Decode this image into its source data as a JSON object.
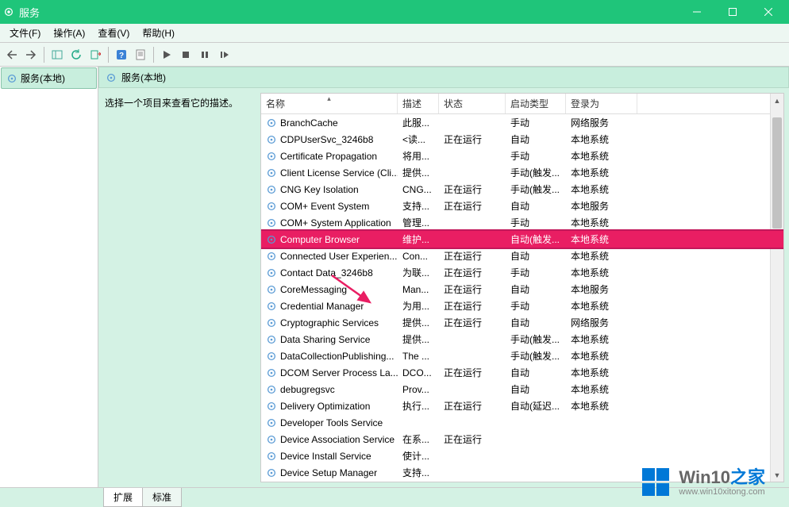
{
  "title": "服务",
  "menu": {
    "file": "文件(F)",
    "action": "操作(A)",
    "view": "查看(V)",
    "help": "帮助(H)"
  },
  "tree": {
    "root": "服务(本地)"
  },
  "pane": {
    "title": "服务(本地)",
    "desc_placeholder": "选择一个项目来查看它的描述。"
  },
  "columns": {
    "name": "名称",
    "desc": "描述",
    "state": "状态",
    "startup": "启动类型",
    "logon": "登录为"
  },
  "services": [
    {
      "name": "BranchCache",
      "desc": "此服...",
      "state": "",
      "startup": "手动",
      "logon": "网络服务"
    },
    {
      "name": "CDPUserSvc_3246b8",
      "desc": "<读...",
      "state": "正在运行",
      "startup": "自动",
      "logon": "本地系统"
    },
    {
      "name": "Certificate Propagation",
      "desc": "将用...",
      "state": "",
      "startup": "手动",
      "logon": "本地系统"
    },
    {
      "name": "Client License Service (Cli...",
      "desc": "提供...",
      "state": "",
      "startup": "手动(触发...",
      "logon": "本地系统"
    },
    {
      "name": "CNG Key Isolation",
      "desc": "CNG...",
      "state": "正在运行",
      "startup": "手动(触发...",
      "logon": "本地系统"
    },
    {
      "name": "COM+ Event System",
      "desc": "支持...",
      "state": "正在运行",
      "startup": "自动",
      "logon": "本地服务"
    },
    {
      "name": "COM+ System Application",
      "desc": "管理...",
      "state": "",
      "startup": "手动",
      "logon": "本地系统"
    },
    {
      "name": "Computer Browser",
      "desc": "维护...",
      "state": "",
      "startup": "自动(触发...",
      "logon": "本地系统",
      "highlight": true
    },
    {
      "name": "Connected User Experien...",
      "desc": "Con...",
      "state": "正在运行",
      "startup": "自动",
      "logon": "本地系统"
    },
    {
      "name": "Contact Data_3246b8",
      "desc": "为联...",
      "state": "正在运行",
      "startup": "手动",
      "logon": "本地系统"
    },
    {
      "name": "CoreMessaging",
      "desc": "Man...",
      "state": "正在运行",
      "startup": "自动",
      "logon": "本地服务"
    },
    {
      "name": "Credential Manager",
      "desc": "为用...",
      "state": "正在运行",
      "startup": "手动",
      "logon": "本地系统"
    },
    {
      "name": "Cryptographic Services",
      "desc": "提供...",
      "state": "正在运行",
      "startup": "自动",
      "logon": "网络服务"
    },
    {
      "name": "Data Sharing Service",
      "desc": "提供...",
      "state": "",
      "startup": "手动(触发...",
      "logon": "本地系统"
    },
    {
      "name": "DataCollectionPublishing...",
      "desc": "The ...",
      "state": "",
      "startup": "手动(触发...",
      "logon": "本地系统"
    },
    {
      "name": "DCOM Server Process La...",
      "desc": "DCO...",
      "state": "正在运行",
      "startup": "自动",
      "logon": "本地系统"
    },
    {
      "name": "debugregsvc",
      "desc": "Prov...",
      "state": "",
      "startup": "自动",
      "logon": "本地系统"
    },
    {
      "name": "Delivery Optimization",
      "desc": "执行...",
      "state": "正在运行",
      "startup": "自动(延迟...",
      "logon": "本地系统"
    },
    {
      "name": "Developer Tools Service",
      "desc": "",
      "state": "",
      "startup": "",
      "logon": ""
    },
    {
      "name": "Device Association Service",
      "desc": "在系...",
      "state": "正在运行",
      "startup": "",
      "logon": ""
    },
    {
      "name": "Device Install Service",
      "desc": "使计...",
      "state": "",
      "startup": "",
      "logon": ""
    },
    {
      "name": "Device Setup Manager",
      "desc": "支持...",
      "state": "",
      "startup": "",
      "logon": ""
    }
  ],
  "tabs": {
    "extended": "扩展",
    "standard": "标准"
  },
  "watermark": {
    "brand_prefix": "Win10",
    "brand_suffix": "之家",
    "url": "www.win10xitong.com"
  }
}
